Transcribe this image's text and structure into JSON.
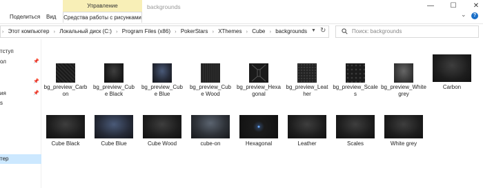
{
  "ribbon": {
    "context_group": "Управление",
    "tabs": [
      "Поделиться",
      "Вид",
      "Средства работы с рисунками"
    ],
    "window_title": "backgrounds"
  },
  "address": {
    "crumbs": [
      "Этот компьютер",
      "Локальный диск (C:)",
      "Program Files (x86)",
      "PokerStars",
      "XThemes",
      "Cube",
      "backgrounds"
    ],
    "search_placeholder": "Поиск: backgrounds"
  },
  "nav": {
    "items": [
      "тступ",
      "ол",
      "",
      "ия",
      "s",
      "тер"
    ]
  },
  "files": [
    {
      "name": "bg_preview_Carbon",
      "lines": [
        "bg_preview_Carb",
        "on"
      ],
      "style": "carbon"
    },
    {
      "name": "bg_preview_Cube Black",
      "lines": [
        "bg_preview_Cub",
        "e Black"
      ],
      "style": "dark"
    },
    {
      "name": "bg_preview_Cube Blue",
      "lines": [
        "bg_preview_Cub",
        "e Blue"
      ],
      "style": "blue"
    },
    {
      "name": "bg_preview_Cube Wood",
      "lines": [
        "bg_preview_Cub",
        "e Wood"
      ],
      "style": "wood"
    },
    {
      "name": "bg_preview_Hexagonal",
      "lines": [
        "bg_preview_Hexa",
        "gonal"
      ],
      "style": "hex"
    },
    {
      "name": "bg_preview_Leather",
      "lines": [
        "bg_preview_Leat",
        "her"
      ],
      "style": "leather"
    },
    {
      "name": "bg_preview_Scales",
      "lines": [
        "bg_preview_Scale",
        "s"
      ],
      "style": "scale"
    },
    {
      "name": "bg_preview_White grey",
      "lines": [
        "bg_preview_White",
        " grey"
      ],
      "style": "grey"
    },
    {
      "name": "Carbon",
      "lines": [
        "Carbon"
      ],
      "style": "dark"
    },
    {
      "name": "Cube Black",
      "lines": [
        "Cube Black"
      ],
      "style": "dark"
    },
    {
      "name": "Cube Blue",
      "lines": [
        "Cube Blue"
      ],
      "style": "blue"
    },
    {
      "name": "Cube Wood",
      "lines": [
        "Cube Wood"
      ],
      "style": "dark"
    },
    {
      "name": "cube-on",
      "lines": [
        "cube-on"
      ],
      "style": "cubeon"
    },
    {
      "name": "Hexagonal",
      "lines": [
        "Hexagonal"
      ],
      "style": "hexbig"
    },
    {
      "name": "Leather",
      "lines": [
        "Leather"
      ],
      "style": "dark"
    },
    {
      "name": "Scales",
      "lines": [
        "Scales"
      ],
      "style": "dark"
    },
    {
      "name": "White grey",
      "lines": [
        "White grey"
      ],
      "style": "dark"
    }
  ]
}
